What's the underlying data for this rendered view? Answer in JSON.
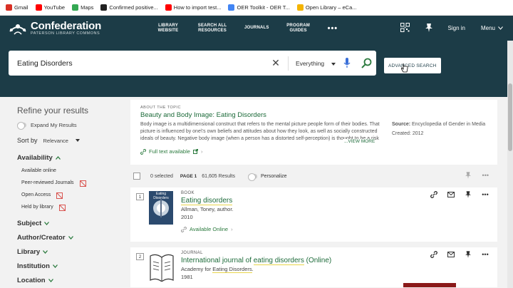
{
  "bookmarks": [
    {
      "label": "Gmail",
      "icon": "gmail-icon",
      "color": "#d93025"
    },
    {
      "label": "YouTube",
      "icon": "youtube-icon",
      "color": "#ff0000"
    },
    {
      "label": "Maps",
      "icon": "maps-icon",
      "color": "#34a853"
    },
    {
      "label": "Confirmed positive...",
      "icon": "github-icon",
      "color": "#222222"
    },
    {
      "label": "How to import test...",
      "icon": "youtube-icon",
      "color": "#ff0000"
    },
    {
      "label": "OER Toolkit - OER T...",
      "icon": "docs-icon",
      "color": "#4285f4"
    },
    {
      "label": "Open Library – eCa...",
      "icon": "bookmark-icon",
      "color": "#f4b400"
    }
  ],
  "header": {
    "logo_title": "Confederation",
    "logo_subtitle": "PATERSON LIBRARY COMMONS",
    "nav": [
      "LIBRARY WEBSITE",
      "SEARCH ALL RESOURCES",
      "JOURNALS",
      "PROGRAM GUIDES"
    ],
    "more": "•••",
    "sign_in": "Sign in",
    "menu": "Menu",
    "color": "#1c3c47"
  },
  "search": {
    "query": "Eating Disorders",
    "scope": "Everything",
    "advanced": "ADVANCED SEARCH"
  },
  "refine": {
    "title": "Refine your results",
    "expand": "Expand My Results",
    "sort_label": "Sort by",
    "sort_value": "Relevance",
    "availability_label": "Availability",
    "availability_items": [
      "Available online",
      "Peer-reviewed Journals",
      "Open Access",
      "Held by library"
    ],
    "facets": [
      "Subject",
      "Author/Creator",
      "Library",
      "Institution",
      "Location"
    ]
  },
  "about": {
    "label": "ABOUT THE TOPIC",
    "title": "Beauty and Body Image: Eating Disorders",
    "text": "Body image is a multidimensional construct that refers to the mental picture people form of their bodies. That picture is influenced by one\\'s own beliefs and attitudes about how they look, as well as socially constructed ideals of beauty. Negative body image (when a person has a distorted self-perception) is thought to be a risk factor for the development of",
    "view_more": "...VIEW MORE",
    "full_text": "Full text available",
    "source_label": "Source:",
    "source_value": "Encyclopedia of Gender in Media",
    "created_label": "Created:",
    "created_value": "2012"
  },
  "results_bar": {
    "selected": "0 selected",
    "page": "PAGE 1",
    "count": "61,605 Results",
    "personalize": "Personalize"
  },
  "results": [
    {
      "num": "1",
      "type": "BOOK",
      "title": "Eating disorders",
      "author": "Allman, Toney, author.",
      "year": "2010",
      "availability": "Available Online",
      "cover_label": "Eating Disorders"
    },
    {
      "num": "2",
      "type": "JOURNAL",
      "title_pre": "International journal of ",
      "title_hl": "eating disorders",
      "title_post": " (Online)",
      "author_pre": "Academy for ",
      "author_hl": "Eating Disorders",
      "author_post": ".",
      "year": "1981"
    }
  ]
}
